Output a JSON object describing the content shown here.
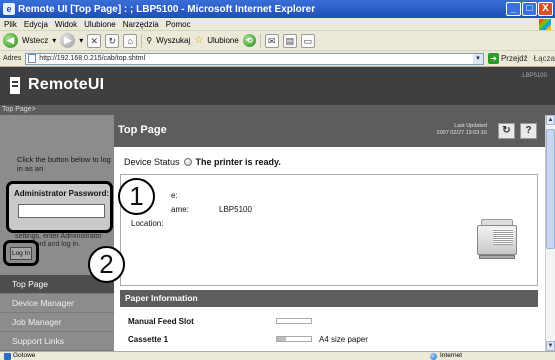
{
  "window": {
    "title": "Remote UI [Top Page] : ; LBP5100 - Microsoft Internet Explorer",
    "buttons": [
      "_",
      "□",
      "X"
    ]
  },
  "menubar": [
    "Plik",
    "Edycja",
    "Widok",
    "Ulubione",
    "Narzędzia",
    "Pomoc"
  ],
  "toolbar": {
    "back_label": "Wstecz",
    "search_label": "Wyszukaj",
    "favorites_label": "Ulubione"
  },
  "address": {
    "label": "Adres",
    "url": "http://192.168.0.215/cab/top.shtml",
    "go_label": "Przejdź",
    "links_label": "Łącza"
  },
  "header": {
    "logo_text": "RemoteUI",
    "model": "LBP5100"
  },
  "breadcrumb": "Top Page>",
  "sidebar": {
    "note": "Click the button below to log in as an",
    "admin_label": "Administrator Password:",
    "note2": "settings, enter Administrator Password and log in.",
    "login_label": "Log In",
    "nav": [
      "Top Page",
      "Device Manager",
      "Job Manager",
      "Support Links"
    ]
  },
  "content": {
    "page_title": "Top Page",
    "last_updated_label": "Last Updated",
    "last_updated_value": "2007 02/27 13:03:15",
    "refresh_icon": "↻",
    "help_label": "?",
    "device_status_label": "Device Status",
    "device_status_value": "The printer is ready.",
    "info": {
      "name_label": "e:",
      "printer_name_label": "ame:",
      "printer_name_value": "LBP5100",
      "location_label": "Location:"
    },
    "paper_header": "Paper Information",
    "paper_rows": [
      {
        "label": "Manual Feed Slot",
        "size": "",
        "fill": 0
      },
      {
        "label": "Cassette 1",
        "size": "A4 size paper",
        "fill": 0.25
      }
    ]
  },
  "callouts": [
    "1",
    "2"
  ],
  "statusbar": {
    "left": "Gotowe",
    "right": "Internet"
  },
  "colors": {
    "header_bg": "#3f3f3f",
    "sidebar_bg": "#8c8c8c",
    "section_bg": "#5d5d5d",
    "titlebar_blue": "#1f4fb5"
  }
}
